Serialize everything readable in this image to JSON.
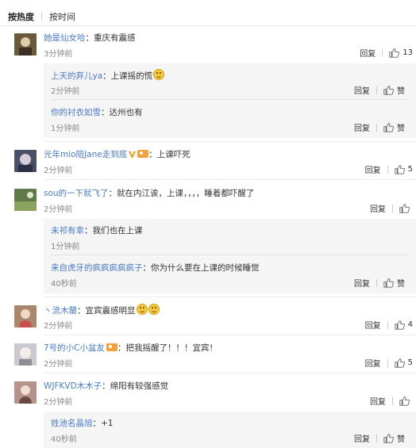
{
  "tabs": {
    "hot": "按热度",
    "time": "按时间"
  },
  "labels": {
    "reply": "回复",
    "like": "赞"
  },
  "comments": [
    {
      "user": "她是仙女哈",
      "text": "重庆有震感",
      "time": "3分钟前",
      "likes": "13",
      "avatar_color": "#6a5a3c",
      "replies": [
        {
          "user": "上天的弃儿ya",
          "text": "上课摇的慌",
          "time": "2分钟前",
          "emoji": "emoji-icon"
        },
        {
          "user": "你的衬衣如雪",
          "text": "达州也有",
          "time": "1分钟前"
        }
      ]
    },
    {
      "user": "光年mio陪Jane走到底",
      "text": "上课吓死",
      "time": "2分钟前",
      "likes": "5",
      "avatar_color": "#4a4f66"
    },
    {
      "user": "sou的一下就飞了",
      "text": "就在内江诶，上课，，，，睡着都吓醒了",
      "time": "2分钟前",
      "likes": "",
      "avatar_color": "#5f7a4a",
      "replies": [
        {
          "user": "未祁有幸",
          "text": "我们也在上课",
          "time": "1分钟前"
        },
        {
          "user": "来自虎牙的疯疯疯疯疯子",
          "text": "你为什么要在上课的时候睡觉",
          "time": "40秒前"
        }
      ]
    },
    {
      "user": "丶流木蘭",
      "text": "宜宾震感明显",
      "time": "2分钟前",
      "likes": "4",
      "avatar_color": "#a8876a"
    },
    {
      "user": "7号的小C小盆友",
      "text": "把我摇醒了！！！宜宾！",
      "time": "2分钟前",
      "likes": "5",
      "avatar_color": "#c9c9cf"
    },
    {
      "user": "WJFKVD木木子",
      "text": "绵阳有较强感觉",
      "time": "2分钟前",
      "likes": "",
      "avatar_color": "#b7928a",
      "replies": [
        {
          "user": "姓池名晶旭",
          "text": "+1",
          "time": "40秒前"
        }
      ]
    }
  ]
}
